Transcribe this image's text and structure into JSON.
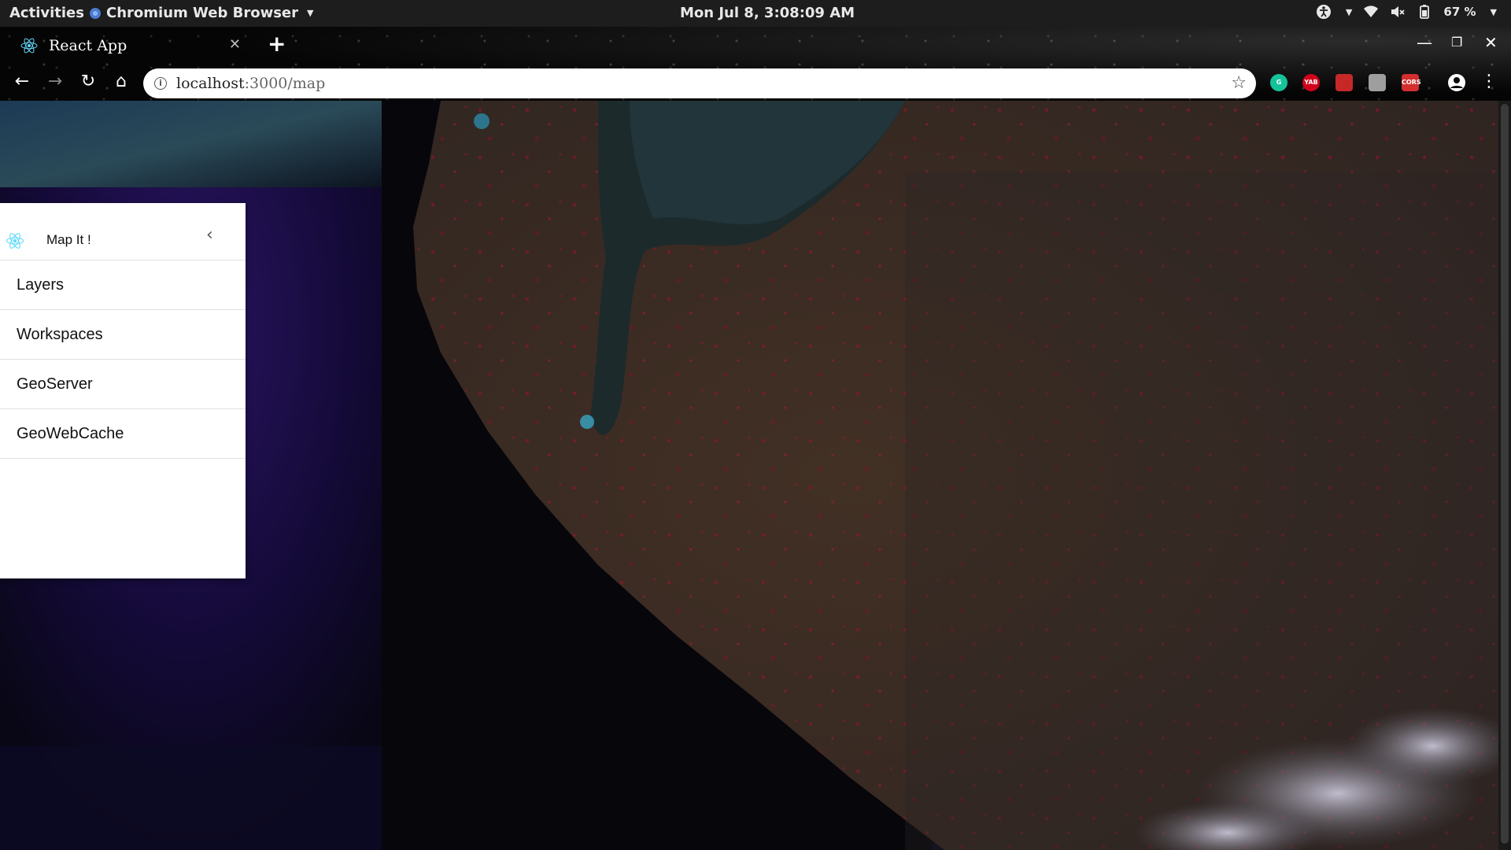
{
  "system_bar": {
    "activities": "Activities",
    "app_name": "Chromium Web Browser",
    "clock": "Mon Jul  8,  3:08:09 AM",
    "battery": "67 %"
  },
  "browser": {
    "tab_title": "React App",
    "url_host": "localhost",
    "url_rest": ":3000/map",
    "extensions": [
      {
        "name": "grammarly-icon",
        "label": "",
        "color": "#15c39a"
      },
      {
        "name": "yab-icon",
        "label": "YAB",
        "color": "#d0021b"
      },
      {
        "name": "ext-red-icon",
        "label": "",
        "color": "#c62828"
      },
      {
        "name": "ext-gray-icon",
        "label": "",
        "color": "#9e9e9e"
      },
      {
        "name": "cors-icon",
        "label": "CORS",
        "color": "#d32f2f"
      }
    ]
  },
  "sidebar": {
    "title": "Map It !",
    "items": [
      {
        "label": "Layers"
      },
      {
        "label": "Workspaces"
      },
      {
        "label": "GeoServer"
      },
      {
        "label": "GeoWebCache"
      }
    ]
  },
  "colors": {
    "accent_react": "#61dafb",
    "land": "#3a2a24",
    "ocean": "#07060c",
    "vegetation_red": "#b01030"
  }
}
